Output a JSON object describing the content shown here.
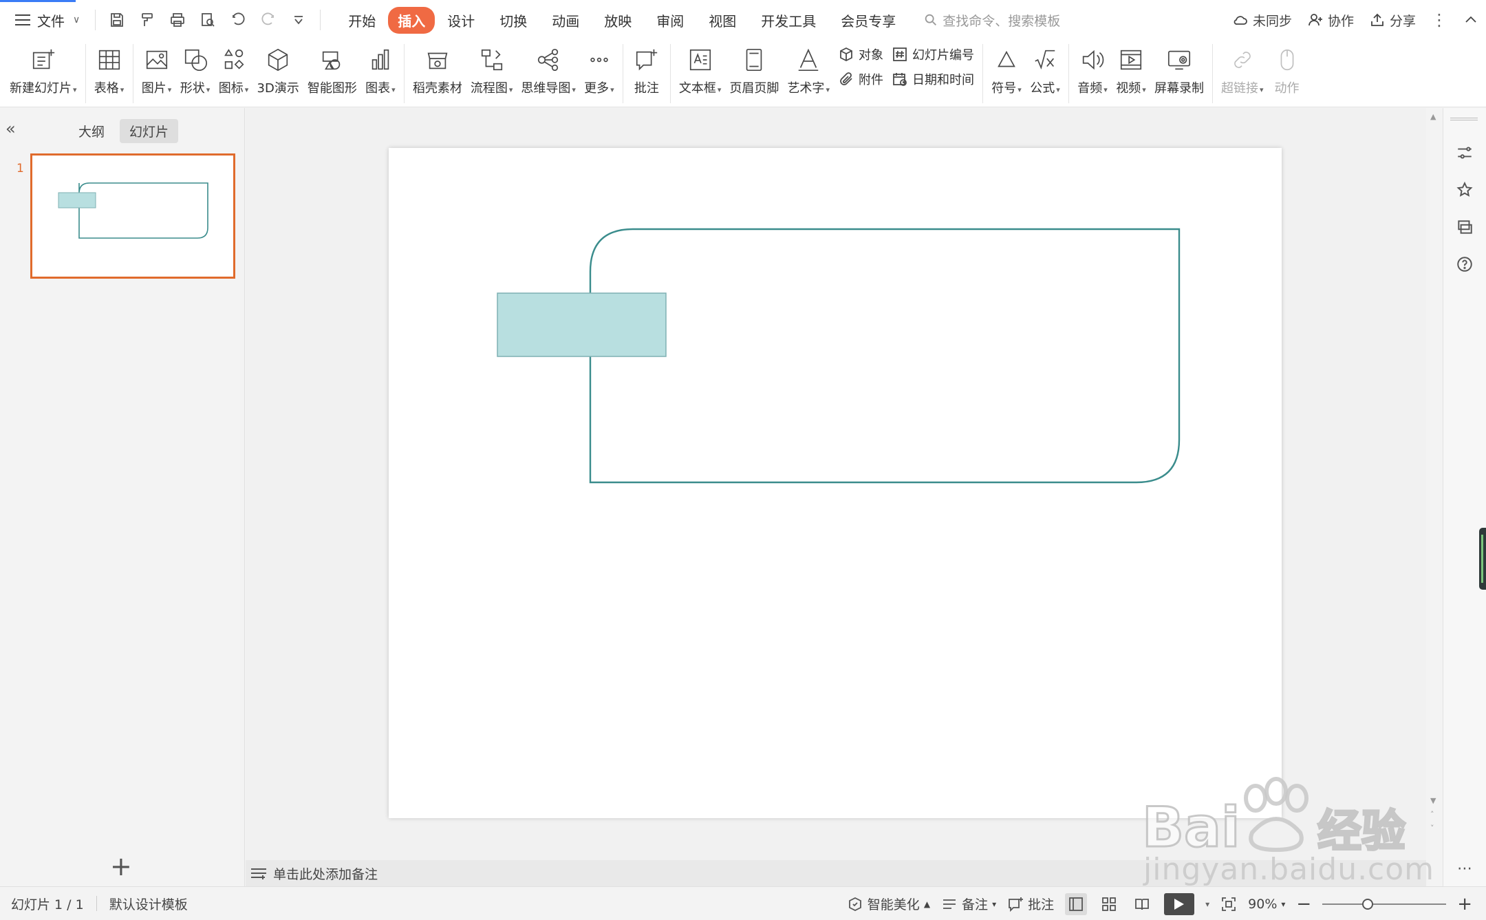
{
  "menu": {
    "file_label": "文件",
    "tabs": [
      "开始",
      "插入",
      "设计",
      "切换",
      "动画",
      "放映",
      "审阅",
      "视图",
      "开发工具",
      "会员专享"
    ],
    "active_tab": "插入",
    "search_placeholder": "查找命令、搜索模板"
  },
  "topright": {
    "sync": "未同步",
    "collab": "协作",
    "share": "分享"
  },
  "ribbon": {
    "new_slide": "新建幻灯片",
    "table": "表格",
    "picture": "图片",
    "shape": "形状",
    "icon": "图标",
    "threed": "3D演示",
    "smart_graphic": "智能图形",
    "chart": "图表",
    "docer_material": "稻壳素材",
    "flowchart": "流程图",
    "mindmap": "思维导图",
    "more": "更多",
    "comment": "批注",
    "textbox": "文本框",
    "header_footer": "页眉页脚",
    "wordart": "艺术字",
    "object": "对象",
    "attachment": "附件",
    "slide_number": "幻灯片编号",
    "date_time": "日期和时间",
    "symbol": "符号",
    "formula": "公式",
    "audio": "音频",
    "video": "视频",
    "screen_record": "屏幕录制",
    "hyperlink": "超链接",
    "action": "动作"
  },
  "left_panel": {
    "tab_outline": "大纲",
    "tab_slides": "幻灯片",
    "active": "幻灯片",
    "slide_number": "1"
  },
  "slide": {
    "outline_color": "#3a8c8c",
    "fill_color": "#b8dfe0",
    "rect_border": "#7fb0b3"
  },
  "notes": {
    "placeholder": "单击此处添加备注"
  },
  "status": {
    "slide_info": "幻灯片 1 / 1",
    "template": "默认设计模板",
    "beautify": "智能美化",
    "notes": "备注",
    "comments": "批注",
    "zoom": "90%",
    "zoom_fraction": 0.35
  },
  "watermark": {
    "url": "jingyan.baidu.com"
  }
}
